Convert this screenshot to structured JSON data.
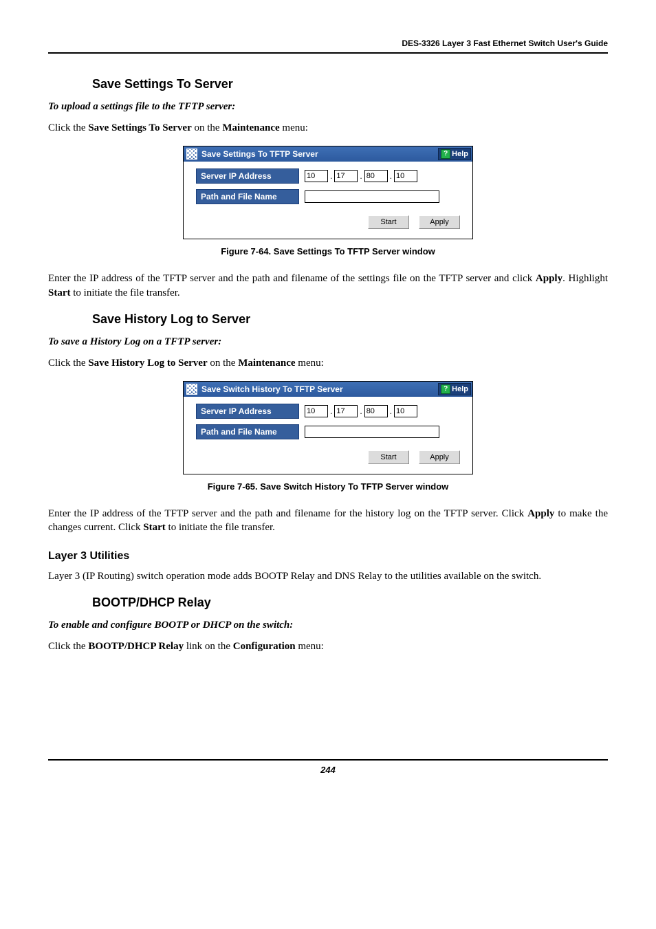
{
  "running_head": "DES-3326 Layer 3 Fast Ethernet Switch User's Guide",
  "section1": {
    "heading": "Save Settings To Server",
    "lead": "To upload a settings file to the TFTP server:",
    "body_html": "Click the <strong>Save Settings To Server</strong> on the <strong>Maintenance</strong> menu:"
  },
  "fig1": {
    "title": "Save Settings To TFTP Server",
    "help": "Help",
    "row_ip_label": "Server IP Address",
    "row_path_label": "Path and File Name",
    "ip": [
      "10",
      "17",
      "80",
      "10"
    ],
    "path_value": "",
    "btn_start": "Start",
    "btn_apply": "Apply",
    "caption": "Figure 7-64.  Save Settings To TFTP Server window"
  },
  "para_after_fig1": "Enter the IP address of the TFTP server and the path and filename of the settings file on the TFTP server and click <strong>Apply</strong>. Highlight <strong>Start</strong> to initiate the file transfer.",
  "section2": {
    "heading": "Save History Log to Server",
    "lead": "To save a History Log on a TFTP server:",
    "body_html": "Click the <strong>Save History Log to Server</strong> on the <strong>Maintenance</strong> menu:"
  },
  "fig2": {
    "title": "Save Switch History To TFTP Server",
    "help": "Help",
    "row_ip_label": "Server IP Address",
    "row_path_label": "Path and File Name",
    "ip": [
      "10",
      "17",
      "80",
      "10"
    ],
    "path_value": "",
    "btn_start": "Start",
    "btn_apply": "Apply",
    "caption": "Figure 7-65.  Save Switch History To TFTP Server window"
  },
  "para_after_fig2": "Enter the IP address of the TFTP server and the path and filename for the history log on the TFTP server. Click <strong>Apply</strong> to make the changes current. Click <strong>Start</strong> to initiate the file transfer.",
  "section3": {
    "heading": "Layer 3 Utilities",
    "body": "Layer 3 (IP Routing) switch operation mode adds BOOTP Relay and DNS Relay to the utilities available on the switch."
  },
  "section4": {
    "heading": "BOOTP/DHCP Relay",
    "lead": "To enable and configure BOOTP or DHCP on the switch:",
    "body_html": "Click the <strong>BOOTP/DHCP Relay</strong> link on the <strong>Configuration</strong> menu:"
  },
  "page_number": "244"
}
